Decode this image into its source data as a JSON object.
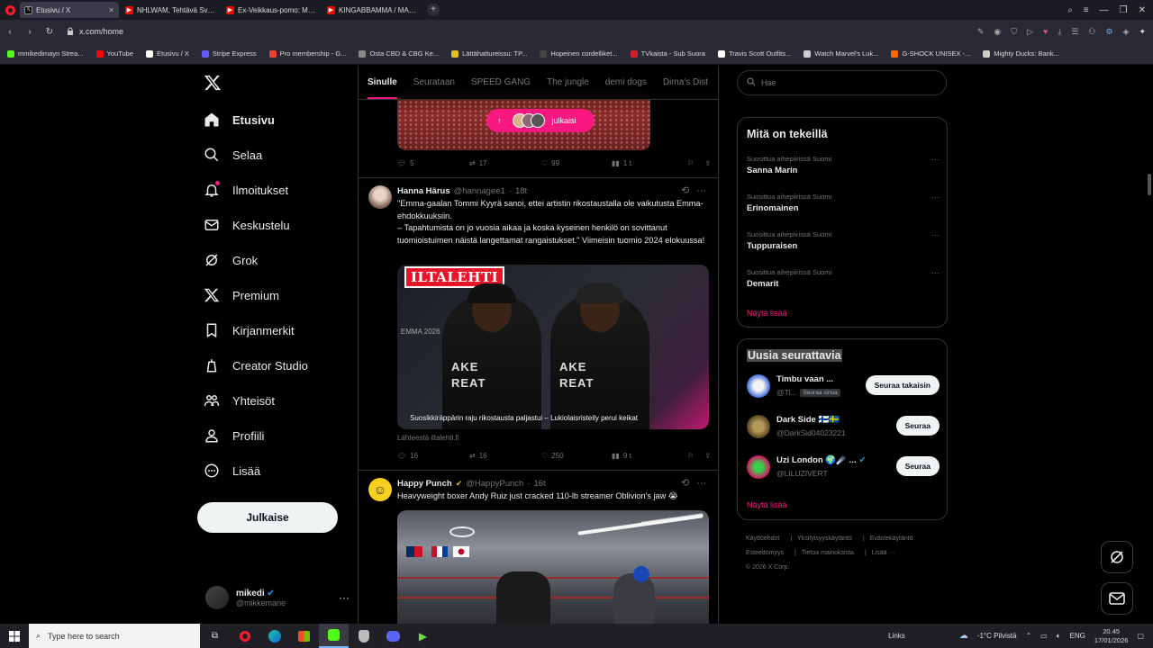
{
  "browser": {
    "tabs": [
      {
        "title": "Etusivu / X",
        "icon": "x-logo-icon",
        "active": true
      },
      {
        "title": "NHLWAM, Tehtävä Sveitsi",
        "icon": "youtube-icon",
        "active": false
      },
      {
        "title": "Ex-Veikkaus-pomo: Miksi",
        "icon": "youtube-icon",
        "active": false
      },
      {
        "title": "KINGABBAMMA / MAANANTAI",
        "icon": "youtube-icon",
        "active": false
      }
    ],
    "url": "x.com/home",
    "bookmarks": [
      {
        "label": "mmikedimayn Strea...",
        "color": "#53fc18"
      },
      {
        "label": "YouTube",
        "color": "#ff0000"
      },
      {
        "label": "Etusivu / X",
        "color": "#ffffff"
      },
      {
        "label": "Stripe Express",
        "color": "#635bff"
      },
      {
        "label": "Pro membership - G...",
        "color": "#ea4335"
      },
      {
        "label": "Osta CBD & CBG Ke...",
        "color": "#888888"
      },
      {
        "label": "Lättähattureissu: TP...",
        "color": "#e0c020"
      },
      {
        "label": "Hopeinen cordelliket...",
        "color": "#444444"
      },
      {
        "label": "TVkaista - Sub Suora",
        "color": "#d0202a"
      },
      {
        "label": "Travis Scott Outfits...",
        "color": "#ffffff"
      },
      {
        "label": "Watch Marvel's Luk...",
        "color": "#cccccc"
      },
      {
        "label": "G-SHOCK UNISEX -...",
        "color": "#ff6a00"
      },
      {
        "label": "Mighty Ducks: Bank...",
        "color": "#cccccc"
      }
    ]
  },
  "nav": {
    "items": [
      {
        "label": "Etusivu",
        "icon": "home-icon",
        "active": true
      },
      {
        "label": "Selaa",
        "icon": "search-icon"
      },
      {
        "label": "Ilmoitukset",
        "icon": "bell-icon"
      },
      {
        "label": "Keskustelu",
        "icon": "mail-icon"
      },
      {
        "label": "Grok",
        "icon": "grok-icon"
      },
      {
        "label": "Premium",
        "icon": "x-premium-icon"
      },
      {
        "label": "Kirjanmerkit",
        "icon": "bookmark-icon"
      },
      {
        "label": "Creator Studio",
        "icon": "creator-studio-icon"
      },
      {
        "label": "Yhteisöt",
        "icon": "communities-icon"
      },
      {
        "label": "Profiili",
        "icon": "profile-icon"
      },
      {
        "label": "Lisää",
        "icon": "more-circle-icon"
      }
    ],
    "post_label": "Julkaise",
    "me": {
      "name": "mikedi",
      "handle": "@mikkemane"
    }
  },
  "feed": {
    "tabs": [
      "Sinulle",
      "Seurataan",
      "SPEED GANG",
      "The jungle",
      "demi dogs",
      "Dima's Dist"
    ],
    "new_posts_label": "julkaisi",
    "tweet0": {
      "replies": "5",
      "reposts": "17",
      "likes": "99",
      "views": "1 t."
    },
    "tweet1": {
      "name": "Hanna Härus",
      "handle": "@hannagee1",
      "time": "18t",
      "text": "\"Emma-gaalan Tommi Kyyrä sanoi, ettei artistin rikostaustalla ole vaikutusta Emma-ehdokkuuksiin.\n– Tapahtumista on jo vuosia aikaa ja koska kyseinen henkilö on sovittanut tuomioistuimen näistä langettamat rangaistukset.\" Viimeisin tuomio 2024 elokuussa!",
      "media_brand": "ILTALEHTI",
      "media_caption": "Suosikkiräppärin raju rikostausta paljastui – Lukiolaisristeily perui keikat",
      "media_shirt_text": "AKE\nREAT",
      "media_watermark": "EMMA 2026",
      "source": "Lähteestä iltalehti.fi",
      "replies": "16",
      "reposts": "16",
      "likes": "250",
      "views": "9 t."
    },
    "tweet2": {
      "name": "Happy Punch",
      "handle": "@HappyPunch",
      "time": "16t",
      "text": "Heavyweight boxer Andy Ruiz just cracked 110-lb streamer Oblivion's jaw 😭"
    }
  },
  "right": {
    "search_placeholder": "Hae",
    "trends_title": "Mitä on tekeillä",
    "trends": [
      {
        "context": "Suosittua aihepiirissä Suomi",
        "title": "Sanna Marin"
      },
      {
        "context": "Suosittua aihepiirissä Suomi",
        "title": "Erinomainen"
      },
      {
        "context": "Suosittua aihepiirissä Suomi",
        "title": "Tuppuraisen"
      },
      {
        "context": "Suosittua aihepiirissä Suomi",
        "title": "Demarit"
      }
    ],
    "show_more": "Näytä lisää",
    "who_title": "Uusia seurattavia",
    "who": [
      {
        "name": "Timbu vaan ...",
        "handle": "@Ti...",
        "badge": "Seuraa sinua",
        "button": "Seuraa takaisin"
      },
      {
        "name": "Dark Side 🇫🇮🇸🇪",
        "handle": "@DarkSid04023221",
        "button": "Seuraa"
      },
      {
        "name": "Uzi London 🌍☄️ ...",
        "handle": "@LILUZIVERT",
        "button": "Seuraa"
      }
    ],
    "footer": [
      "Käyttöehdot",
      "Yksityisyyskäytäntö",
      "Evästekäytäntö",
      "Esteettömyys",
      "Tietoa mainoksista",
      "Lisää ···",
      "© 2026 X Corp."
    ]
  },
  "taskbar": {
    "search_placeholder": "Type here to search",
    "links_label": "Links",
    "weather": "-1°C  Pilvistä",
    "lang": "ENG",
    "time": "20.45",
    "date": "17/01/2026"
  },
  "colors": {
    "accent": "#f91880",
    "bg": "#000000",
    "border": "#2f3336",
    "muted": "#71767b"
  }
}
